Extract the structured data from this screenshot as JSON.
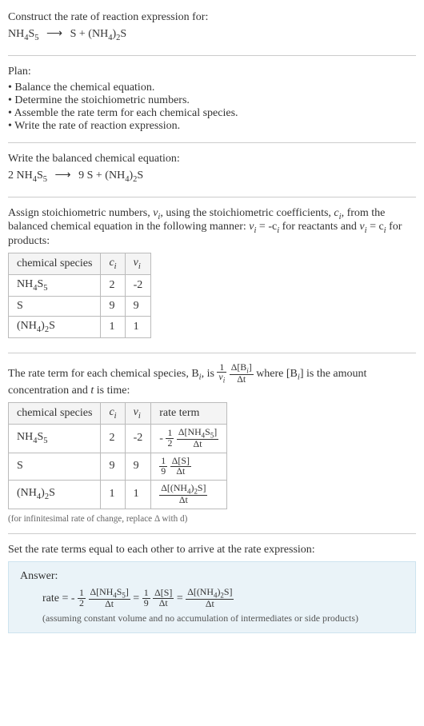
{
  "header": {
    "prompt": "Construct the rate of reaction expression for:",
    "reactant": "NH",
    "reactant_sub1": "4",
    "reactant_s": "S",
    "reactant_sub2": "5",
    "arrow": "⟶",
    "prod1": "S + (NH",
    "prod1_sub1": "4",
    "prod1_close": ")",
    "prod1_sub2": "2",
    "prod1_s": "S"
  },
  "plan": {
    "title": "Plan:",
    "items": [
      "Balance the chemical equation.",
      "Determine the stoichiometric numbers.",
      "Assemble the rate term for each chemical species.",
      "Write the rate of reaction expression."
    ]
  },
  "balanced": {
    "title": "Write the balanced chemical equation:",
    "coef1": "2 NH",
    "sub1a": "4",
    "s1": "S",
    "sub1b": "5",
    "arrow": "⟶",
    "coef2": "9 S + (NH",
    "sub2a": "4",
    "close2": ")",
    "sub2b": "2",
    "s2": "S"
  },
  "assign": {
    "text1": "Assign stoichiometric numbers, ",
    "nu_i": "ν",
    "nu_sub": "i",
    "text2": ", using the stoichiometric coefficients, ",
    "c_i": "c",
    "c_sub": "i",
    "text3": ", from the balanced chemical equation in the following manner: ",
    "eq1a": "ν",
    "eq1b": "i",
    "eq1c": " = -c",
    "eq1d": "i",
    "text4": " for reactants and ",
    "eq2a": "ν",
    "eq2b": "i",
    "eq2c": " = c",
    "eq2d": "i",
    "text5": " for products:"
  },
  "table1": {
    "headers": {
      "col1": "chemical species",
      "col2_c": "c",
      "col2_i": "i",
      "col3_nu": "ν",
      "col3_i": "i"
    },
    "rows": [
      {
        "sp_pre": "NH",
        "sp_sub1": "4",
        "sp_mid": "S",
        "sp_sub2": "5",
        "sp_post": "",
        "c": "2",
        "nu": "-2"
      },
      {
        "sp_pre": "S",
        "sp_sub1": "",
        "sp_mid": "",
        "sp_sub2": "",
        "sp_post": "",
        "c": "9",
        "nu": "9"
      },
      {
        "sp_pre": "(NH",
        "sp_sub1": "4",
        "sp_mid": ")",
        "sp_sub2": "2",
        "sp_post": "S",
        "c": "1",
        "nu": "1"
      }
    ]
  },
  "rateterm_intro": {
    "text1": "The rate term for each chemical species, B",
    "sub_i1": "i",
    "text2": ", is ",
    "frac1_num": "1",
    "frac1_den_nu": "ν",
    "frac1_den_i": "i",
    "frac2_num_d": "Δ[B",
    "frac2_num_i": "i",
    "frac2_num_close": "]",
    "frac2_den": "Δt",
    "text3": " where [B",
    "sub_i2": "i",
    "text4": "] is the amount concentration and ",
    "t": "t",
    "text5": " is time:"
  },
  "table2": {
    "headers": {
      "col1": "chemical species",
      "col2_c": "c",
      "col2_i": "i",
      "col3_nu": "ν",
      "col3_i": "i",
      "col4": "rate term"
    },
    "rows": [
      {
        "sp_pre": "NH",
        "sp_sub1": "4",
        "sp_mid": "S",
        "sp_sub2": "5",
        "sp_post": "",
        "c": "2",
        "nu": "-2",
        "rt_coef_sign": "-",
        "rt_coef_num": "1",
        "rt_coef_den": "2",
        "rt_num_pre": "Δ[NH",
        "rt_num_s1": "4",
        "rt_num_mid": "S",
        "rt_num_s2": "5",
        "rt_num_post": "]",
        "rt_den": "Δt"
      },
      {
        "sp_pre": "S",
        "sp_sub1": "",
        "sp_mid": "",
        "sp_sub2": "",
        "sp_post": "",
        "c": "9",
        "nu": "9",
        "rt_coef_sign": "",
        "rt_coef_num": "1",
        "rt_coef_den": "9",
        "rt_num_pre": "Δ[S",
        "rt_num_s1": "",
        "rt_num_mid": "",
        "rt_num_s2": "",
        "rt_num_post": "]",
        "rt_den": "Δt"
      },
      {
        "sp_pre": "(NH",
        "sp_sub1": "4",
        "sp_mid": ")",
        "sp_sub2": "2",
        "sp_post": "S",
        "c": "1",
        "nu": "1",
        "rt_coef_sign": "",
        "rt_coef_num": "",
        "rt_coef_den": "",
        "rt_num_pre": "Δ[(NH",
        "rt_num_s1": "4",
        "rt_num_mid": ")",
        "rt_num_s2": "2",
        "rt_num_post": "S]",
        "rt_den": "Δt"
      }
    ],
    "footnote": "(for infinitesimal rate of change, replace Δ with d)"
  },
  "conclusion": {
    "text": "Set the rate terms equal to each other to arrive at the rate expression:"
  },
  "answer": {
    "label": "Answer:",
    "rate_lead": "rate = -",
    "f1_num": "1",
    "f1_den": "2",
    "f2_num_pre": "Δ[NH",
    "f2_num_s1": "4",
    "f2_num_mid": "S",
    "f2_num_s2": "5",
    "f2_num_post": "]",
    "f2_den": "Δt",
    "eq1": " = ",
    "f3_num": "1",
    "f3_den": "9",
    "f4_num": "Δ[S]",
    "f4_den": "Δt",
    "eq2": " = ",
    "f5_num_pre": "Δ[(NH",
    "f5_num_s1": "4",
    "f5_num_mid": ")",
    "f5_num_s2": "2",
    "f5_num_post": "S]",
    "f5_den": "Δt",
    "assume": "(assuming constant volume and no accumulation of intermediates or side products)"
  }
}
